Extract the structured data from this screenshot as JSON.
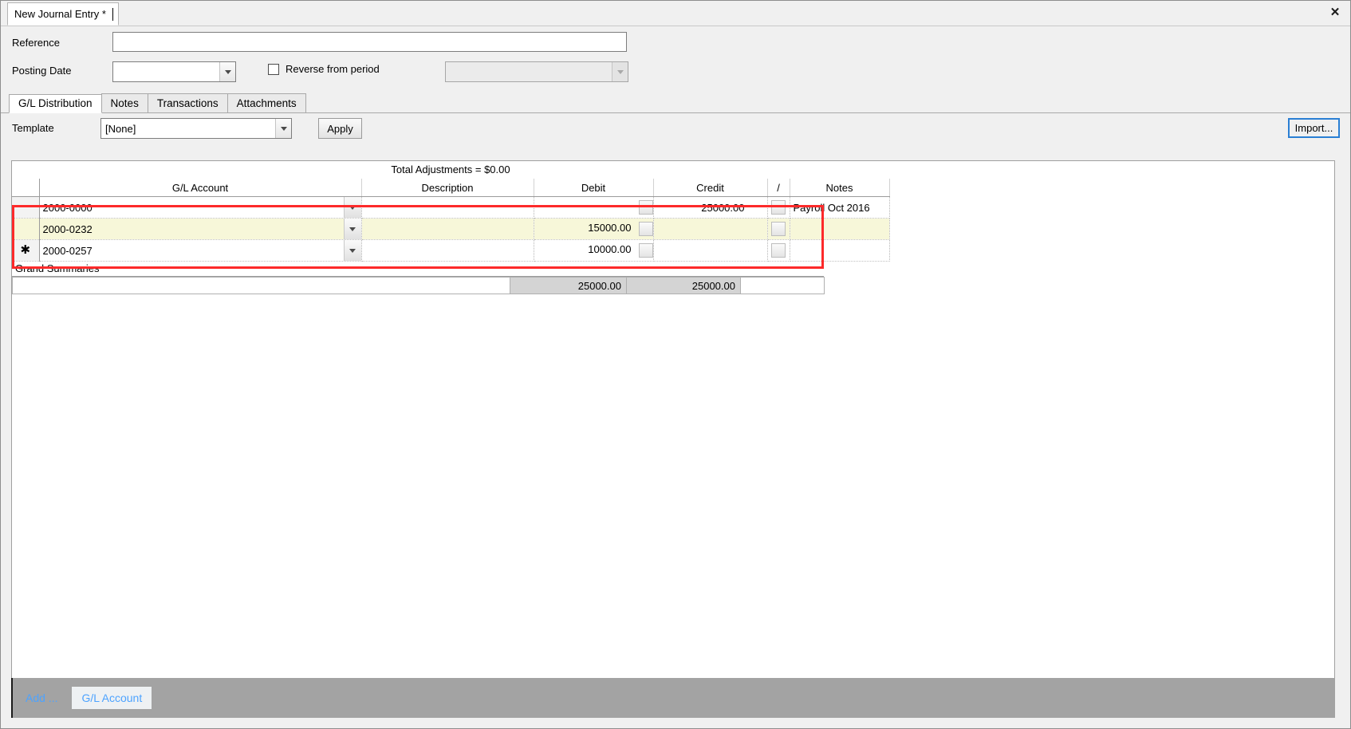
{
  "window": {
    "doc_tab_title": "New Journal Entry *",
    "close_icon": "close-icon"
  },
  "form": {
    "reference_label": "Reference",
    "reference_value": "",
    "reference_placeholder": "",
    "posting_date_label": "Posting Date",
    "posting_date_value": "",
    "reverse_checkbox_label": "Reverse from period",
    "reverse_period_value": ""
  },
  "tabs": [
    {
      "label": "G/L Distribution",
      "active": true
    },
    {
      "label": "Notes",
      "active": false
    },
    {
      "label": "Transactions",
      "active": false
    },
    {
      "label": "Attachments",
      "active": false
    }
  ],
  "template_row": {
    "template_label": "Template",
    "template_value": "[None]",
    "apply_label": "Apply",
    "import_label": "Import..."
  },
  "grid": {
    "total_adjustments": "Total Adjustments = $0.00",
    "columns": [
      "G/L Account",
      "Description",
      "Debit",
      "Credit",
      "/",
      "Notes"
    ],
    "rows": [
      {
        "marker": "",
        "account": "2000-0000",
        "description": "",
        "debit": "",
        "credit": "25000.00",
        "notes": "Payroll Oct 2016",
        "highlight": false
      },
      {
        "marker": "",
        "account": "2000-0232",
        "description": "",
        "debit": "15000.00",
        "credit": "",
        "notes": "",
        "highlight": true
      },
      {
        "marker": "✱",
        "account": "2000-0257",
        "description": "",
        "debit": "10000.00",
        "credit": "",
        "notes": "",
        "highlight": false
      }
    ],
    "grand_summaries_label": "Grand Summaries",
    "grand_total_debit": "25000.00",
    "grand_total_credit": "25000.00"
  },
  "bottom_bar": {
    "add_label": "Add ...",
    "gl_account_button": "G/L Account"
  },
  "colors": {
    "selection_red": "#fd2a2a",
    "row_highlight": "#f7f7d9",
    "focus_blue": "#2a7fd4",
    "bottom_bar_gray": "#a3a3a3",
    "link_blue": "#4da3ff"
  }
}
